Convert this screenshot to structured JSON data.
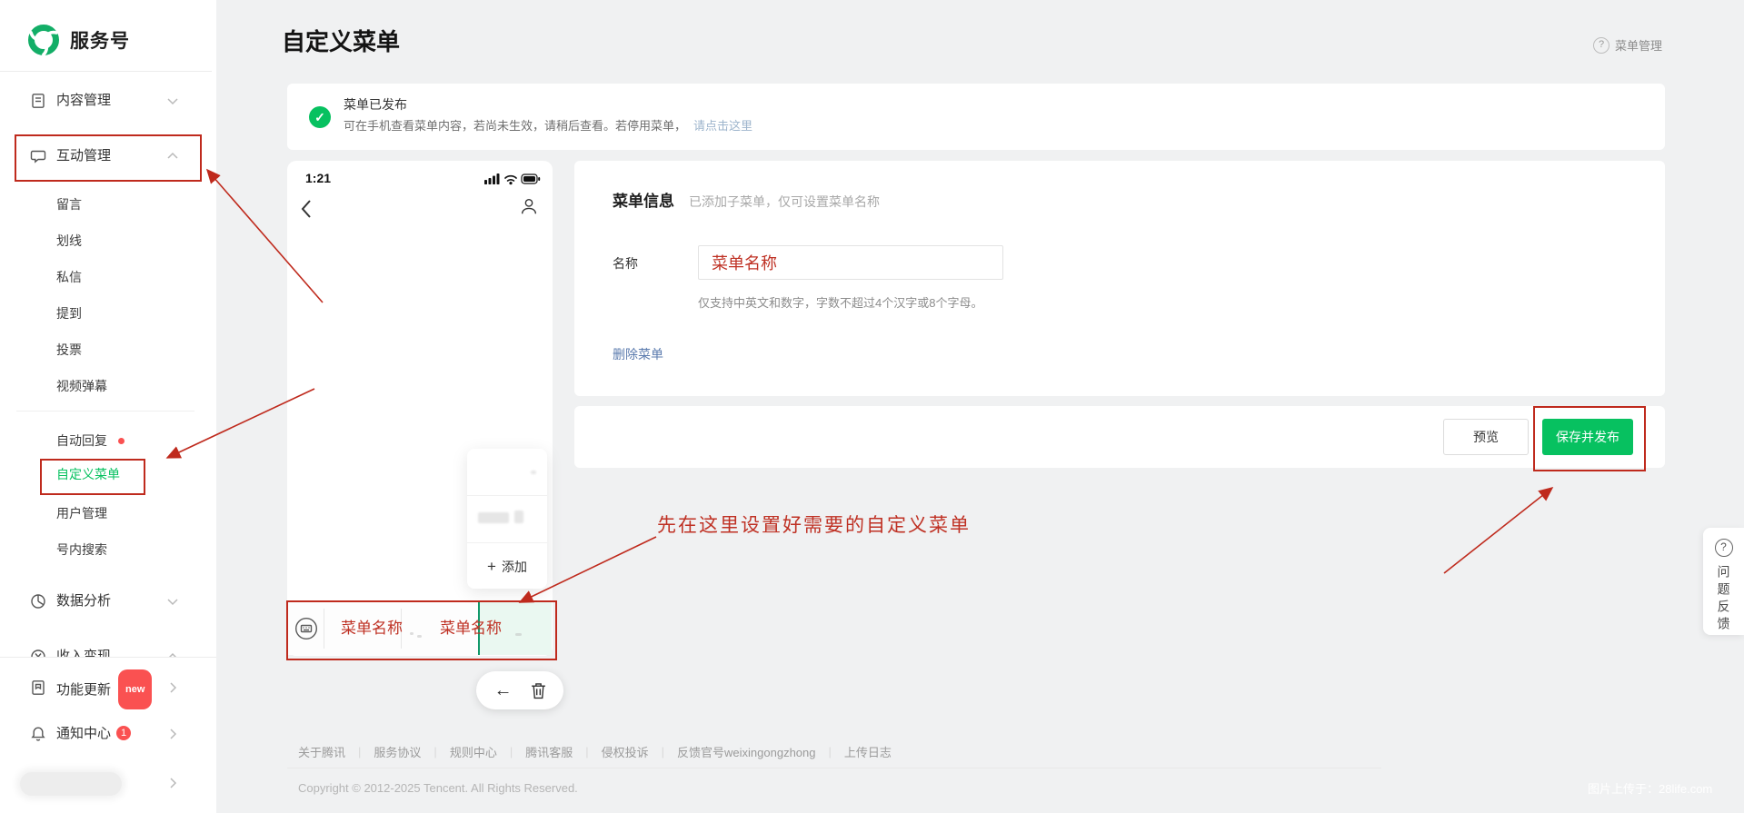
{
  "colors": {
    "accent": "#07c160",
    "annotation_red": "#bf2a1d",
    "badge_red": "#fa5151",
    "link_blue": "#5b7bae"
  },
  "sidebar": {
    "brand": "服务号",
    "content_mgmt": "内容管理",
    "interaction_mgmt": "互动管理",
    "children": [
      "留言",
      "划线",
      "私信",
      "提到",
      "投票",
      "视频弹幕"
    ],
    "tools": [
      "自动回复",
      "自定义菜单",
      "用户管理",
      "号内搜索"
    ],
    "analysis": "数据分析",
    "monetize": "收入变现",
    "feature_update": {
      "label": "功能更新",
      "badge": "new"
    },
    "notification_center": {
      "label": "通知中心",
      "badge": "1"
    }
  },
  "header": {
    "title": "自定义菜单",
    "help": "菜单管理",
    "help_icon": "?"
  },
  "notice": {
    "check": "✓",
    "title": "菜单已发布",
    "body": "可在手机查看菜单内容，若尚未生效，请稍后查看。若停用菜单，",
    "link": "请点击这里"
  },
  "phone": {
    "time": "1:21",
    "popup_add": "添加",
    "plus": "+",
    "menu1": "菜单名称",
    "menu2": "菜单名称",
    "back_arrow": "←"
  },
  "form": {
    "section_title": "菜单信息",
    "section_hint": "已添加子菜单，仅可设置菜单名称",
    "name_label": "名称",
    "name_value": "菜单名称",
    "helper": "仅支持中英文和数字，字数不超过4个汉字或8个字母。",
    "delete_link": "删除菜单"
  },
  "actions": {
    "preview": "预览",
    "save": "保存并发布"
  },
  "annotation": {
    "tip": "先在这里设置好需要的自定义菜单"
  },
  "feedback": {
    "icon": "?",
    "label": "问题反馈"
  },
  "footer": {
    "links": [
      "关于腾讯",
      "服务协议",
      "规则中心",
      "腾讯客服",
      "侵权投诉",
      "反馈官号weixingongzhong",
      "上传日志"
    ],
    "separator": "|",
    "copyright": "Copyright © 2012-2025 Tencent. All Rights Reserved."
  },
  "watermark": "图片上传于：28life.com"
}
